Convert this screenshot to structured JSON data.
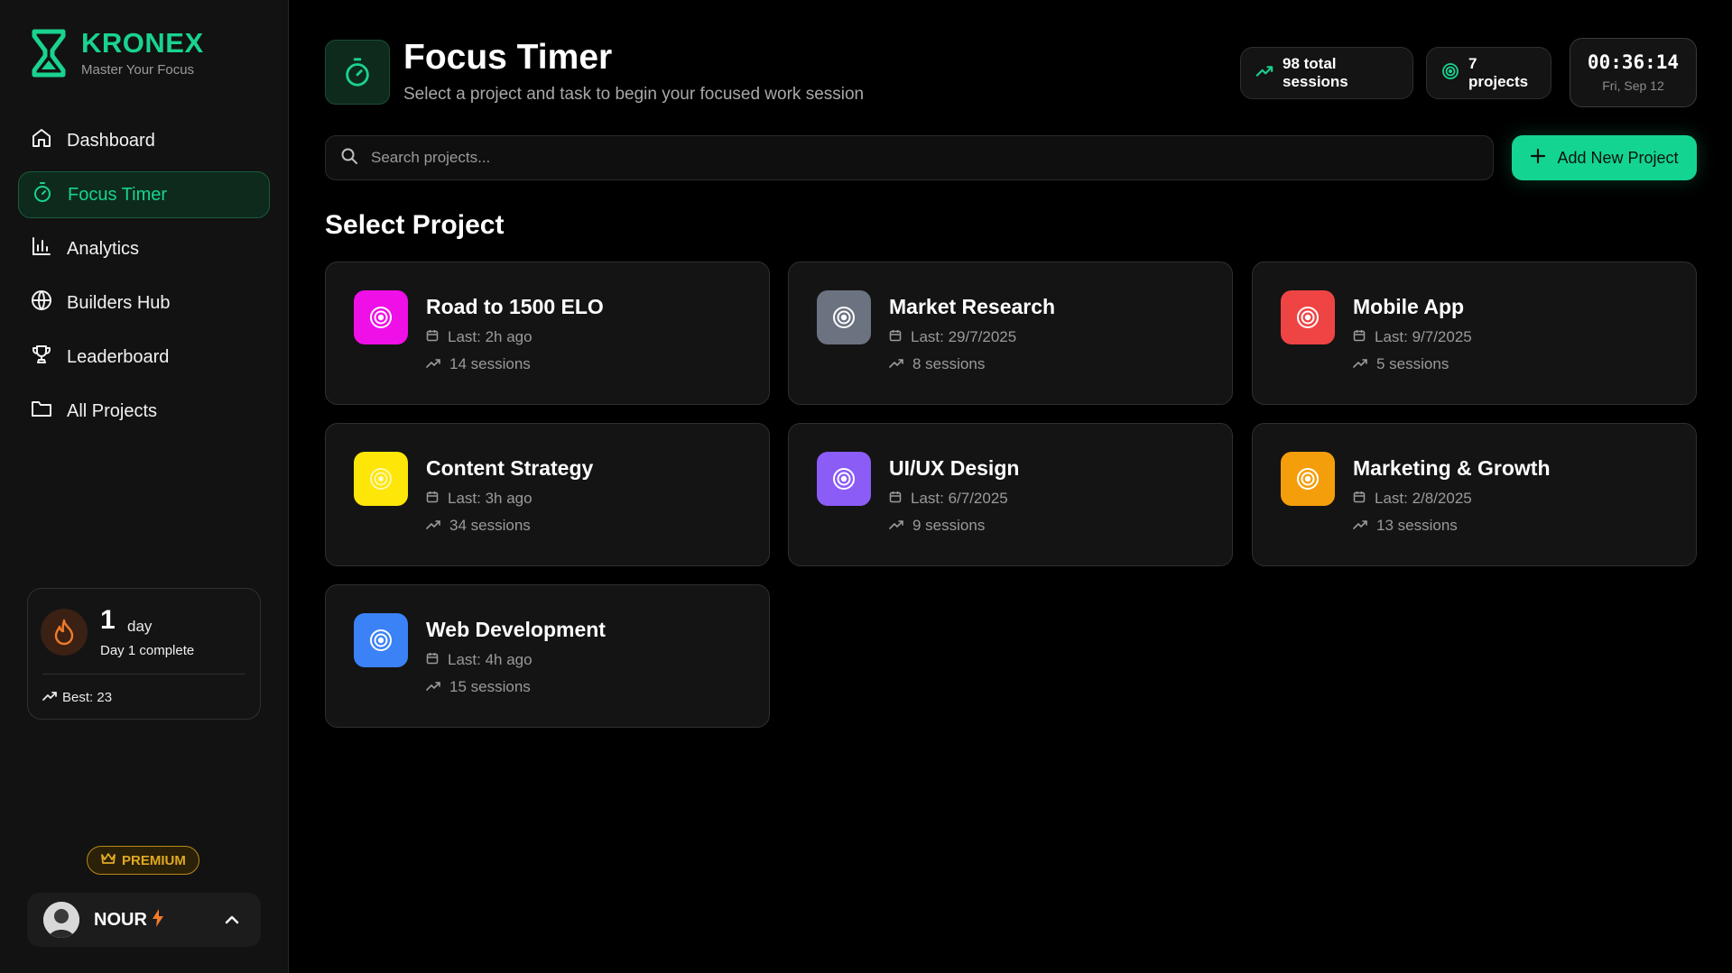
{
  "brand": {
    "name": "KRONEX",
    "tagline": "Master Your Focus"
  },
  "nav": [
    {
      "label": "Dashboard",
      "icon": "home-icon",
      "active": false
    },
    {
      "label": "Focus Timer",
      "icon": "timer-icon",
      "active": true
    },
    {
      "label": "Analytics",
      "icon": "bar-chart-icon",
      "active": false
    },
    {
      "label": "Builders Hub",
      "icon": "globe-icon",
      "active": false
    },
    {
      "label": "Leaderboard",
      "icon": "trophy-icon",
      "active": false
    },
    {
      "label": "All Projects",
      "icon": "folder-icon",
      "active": false
    }
  ],
  "streak": {
    "count": "1",
    "unit": "day",
    "subtitle": "Day 1 complete",
    "best": "Best: 23"
  },
  "premium": {
    "label": "PREMIUM"
  },
  "user": {
    "name": "NOUR"
  },
  "header": {
    "title": "Focus Timer",
    "subtitle": "Select a project and task to begin your focused work session",
    "total_sessions": "98 total sessions",
    "projects_count": "7 projects",
    "clock_time": "00:36:14",
    "clock_date": "Fri, Sep 12"
  },
  "search": {
    "placeholder": "Search projects..."
  },
  "add_button": {
    "label": "Add New Project"
  },
  "section_title": "Select Project",
  "projects": [
    {
      "name": "Road to 1500 ELO",
      "last": "Last: 2h ago",
      "sessions": "14 sessions",
      "color": "#ef0fe7"
    },
    {
      "name": "Market Research",
      "last": "Last: 29/7/2025",
      "sessions": "8 sessions",
      "color": "#6b7280"
    },
    {
      "name": "Mobile App",
      "last": "Last: 9/7/2025",
      "sessions": "5 sessions",
      "color": "#ef4444"
    },
    {
      "name": "Content Strategy",
      "last": "Last: 3h ago",
      "sessions": "34 sessions",
      "color": "#fde608"
    },
    {
      "name": "UI/UX Design",
      "last": "Last: 6/7/2025",
      "sessions": "9 sessions",
      "color": "#8b5cf6"
    },
    {
      "name": "Marketing & Growth",
      "last": "Last: 2/8/2025",
      "sessions": "13 sessions",
      "color": "#f59e0b"
    },
    {
      "name": "Web Development",
      "last": "Last: 4h ago",
      "sessions": "15 sessions",
      "color": "#3b82f6"
    }
  ],
  "colors": {
    "accent": "#19d38f",
    "premium": "#e0a923",
    "streak": "#f07a2a"
  }
}
